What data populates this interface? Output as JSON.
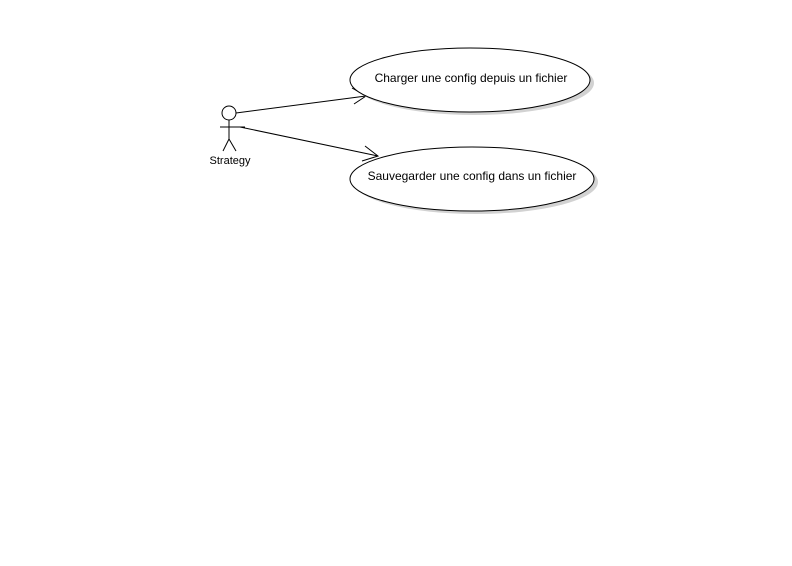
{
  "diagram": {
    "actor": {
      "name": "Strategy"
    },
    "use_cases": [
      {
        "label": "Charger une config depuis un fichier"
      },
      {
        "label": "Sauvegarder une config dans un fichier"
      }
    ],
    "associations": [
      {
        "from": "Strategy",
        "to": "Charger une config depuis un fichier"
      },
      {
        "from": "Strategy",
        "to": "Sauvegarder une config dans un fichier"
      }
    ]
  }
}
